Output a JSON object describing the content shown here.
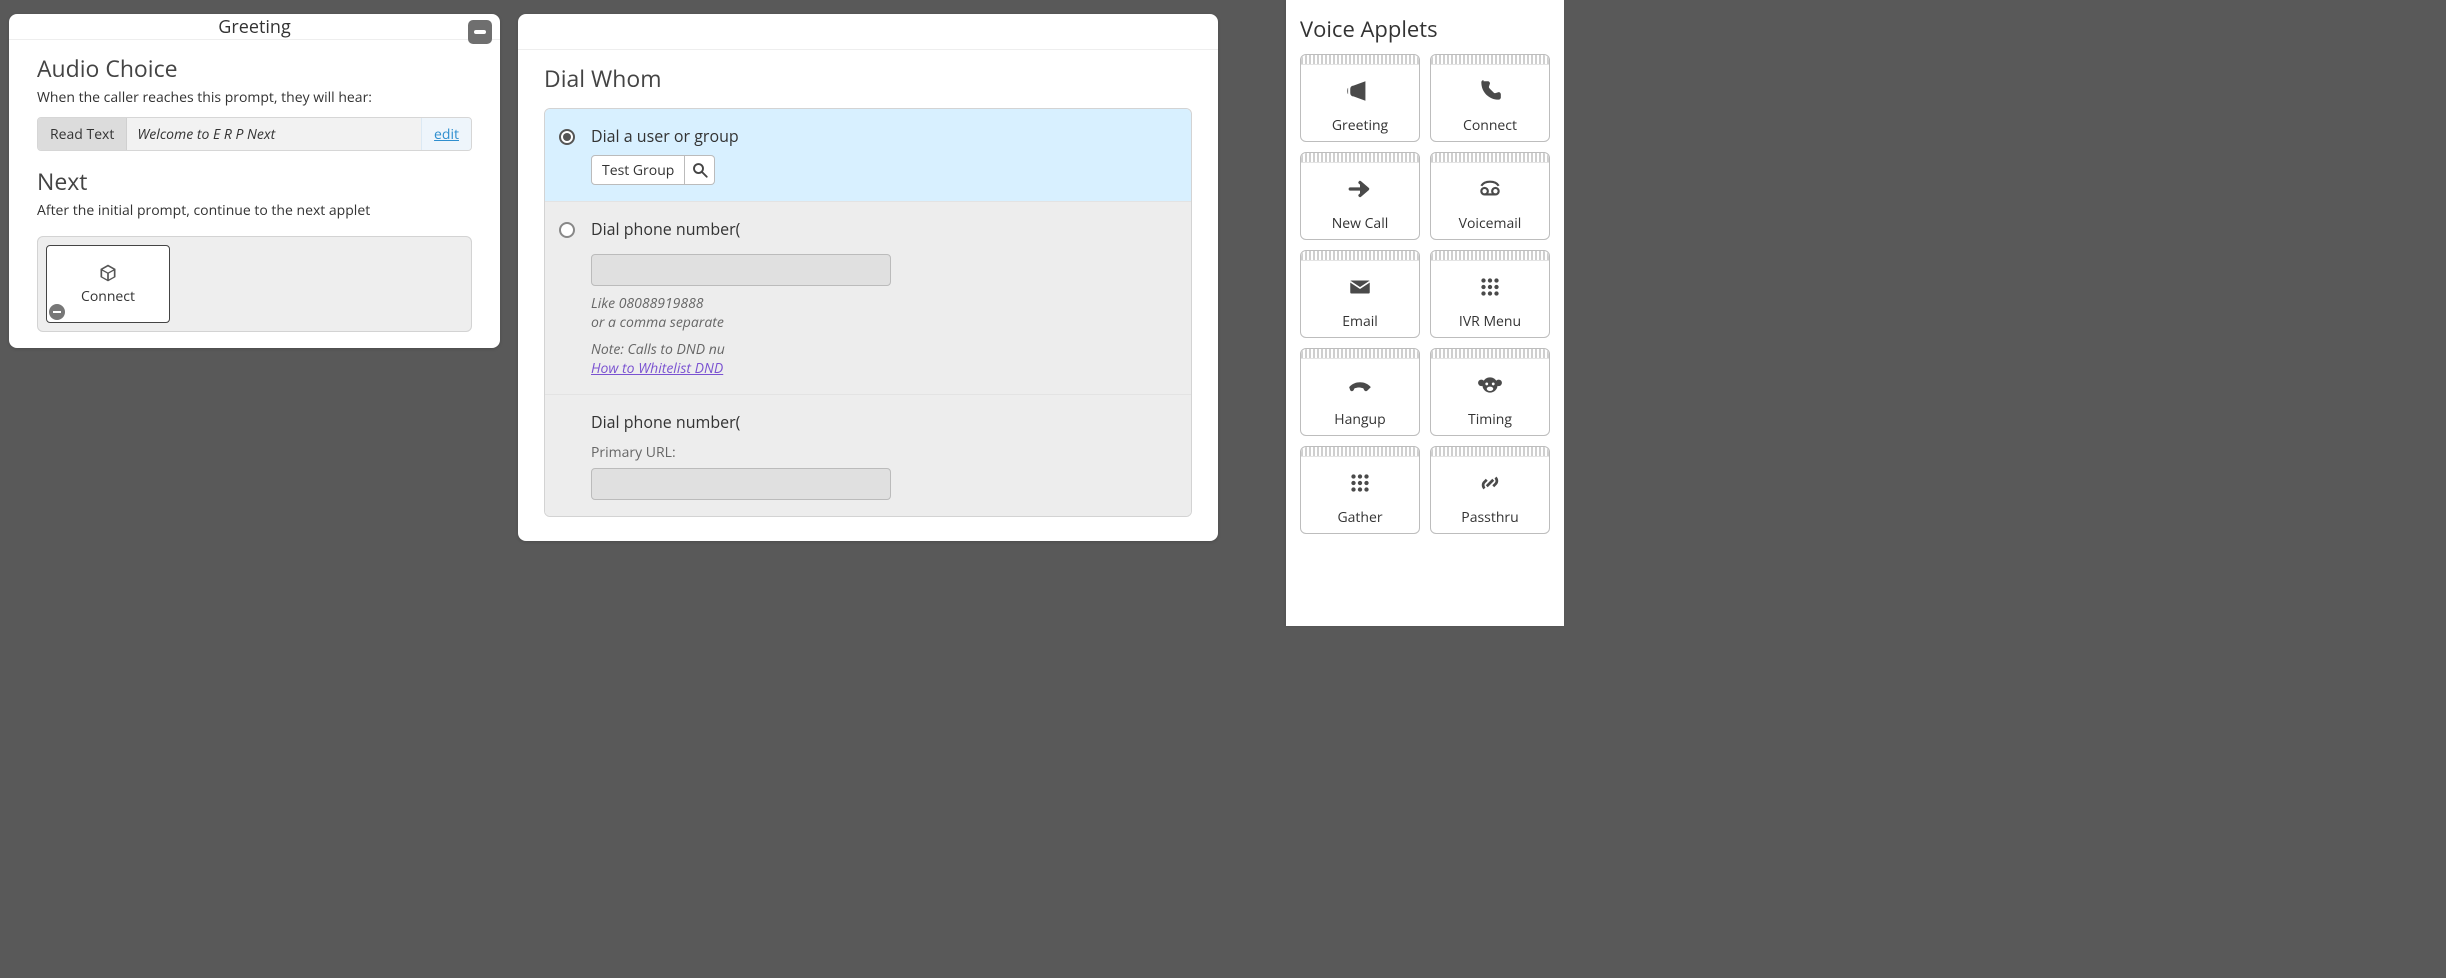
{
  "greeting": {
    "title": "Greeting",
    "section_audio": "Audio Choice",
    "audio_hint": "When the caller reaches this prompt, they will hear:",
    "read_tag": "Read Text",
    "read_text": "Welcome to E R P Next",
    "edit": "edit",
    "section_next": "Next",
    "next_hint": "After the initial prompt, continue to the next applet",
    "next_applet": "Connect"
  },
  "dial": {
    "title": "Dial Whom",
    "options": [
      {
        "label": "Dial a user or group",
        "selected": true,
        "value": "Test Group"
      },
      {
        "label": "Dial phone number(",
        "selected": false,
        "hint_example": "Like 08088919888",
        "hint_example2": "or a comma separate",
        "note_prefix": "Note:",
        "note": " Calls to DND nu",
        "link": "How to Whitelist DND"
      },
      {
        "label": "Dial phone number(",
        "selected": false,
        "subfield": "Primary URL:"
      }
    ]
  },
  "palette": {
    "title": "Voice Applets",
    "items": [
      {
        "id": "greeting",
        "label": "Greeting",
        "icon": "megaphone-icon"
      },
      {
        "id": "connect",
        "label": "Connect",
        "icon": "phone-icon"
      },
      {
        "id": "newcall",
        "label": "New Call",
        "icon": "arrow-right-icon"
      },
      {
        "id": "voicemail",
        "label": "Voicemail",
        "icon": "tape-icon"
      },
      {
        "id": "email",
        "label": "Email",
        "icon": "envelope-icon"
      },
      {
        "id": "ivrmenu",
        "label": "IVR Menu",
        "icon": "keypad-icon"
      },
      {
        "id": "hangup",
        "label": "Hangup",
        "icon": "hangup-icon"
      },
      {
        "id": "timing",
        "label": "Timing",
        "icon": "monkey-icon"
      },
      {
        "id": "gather",
        "label": "Gather",
        "icon": "keypad-icon"
      },
      {
        "id": "passthru",
        "label": "Passthru",
        "icon": "link-icon"
      }
    ]
  }
}
